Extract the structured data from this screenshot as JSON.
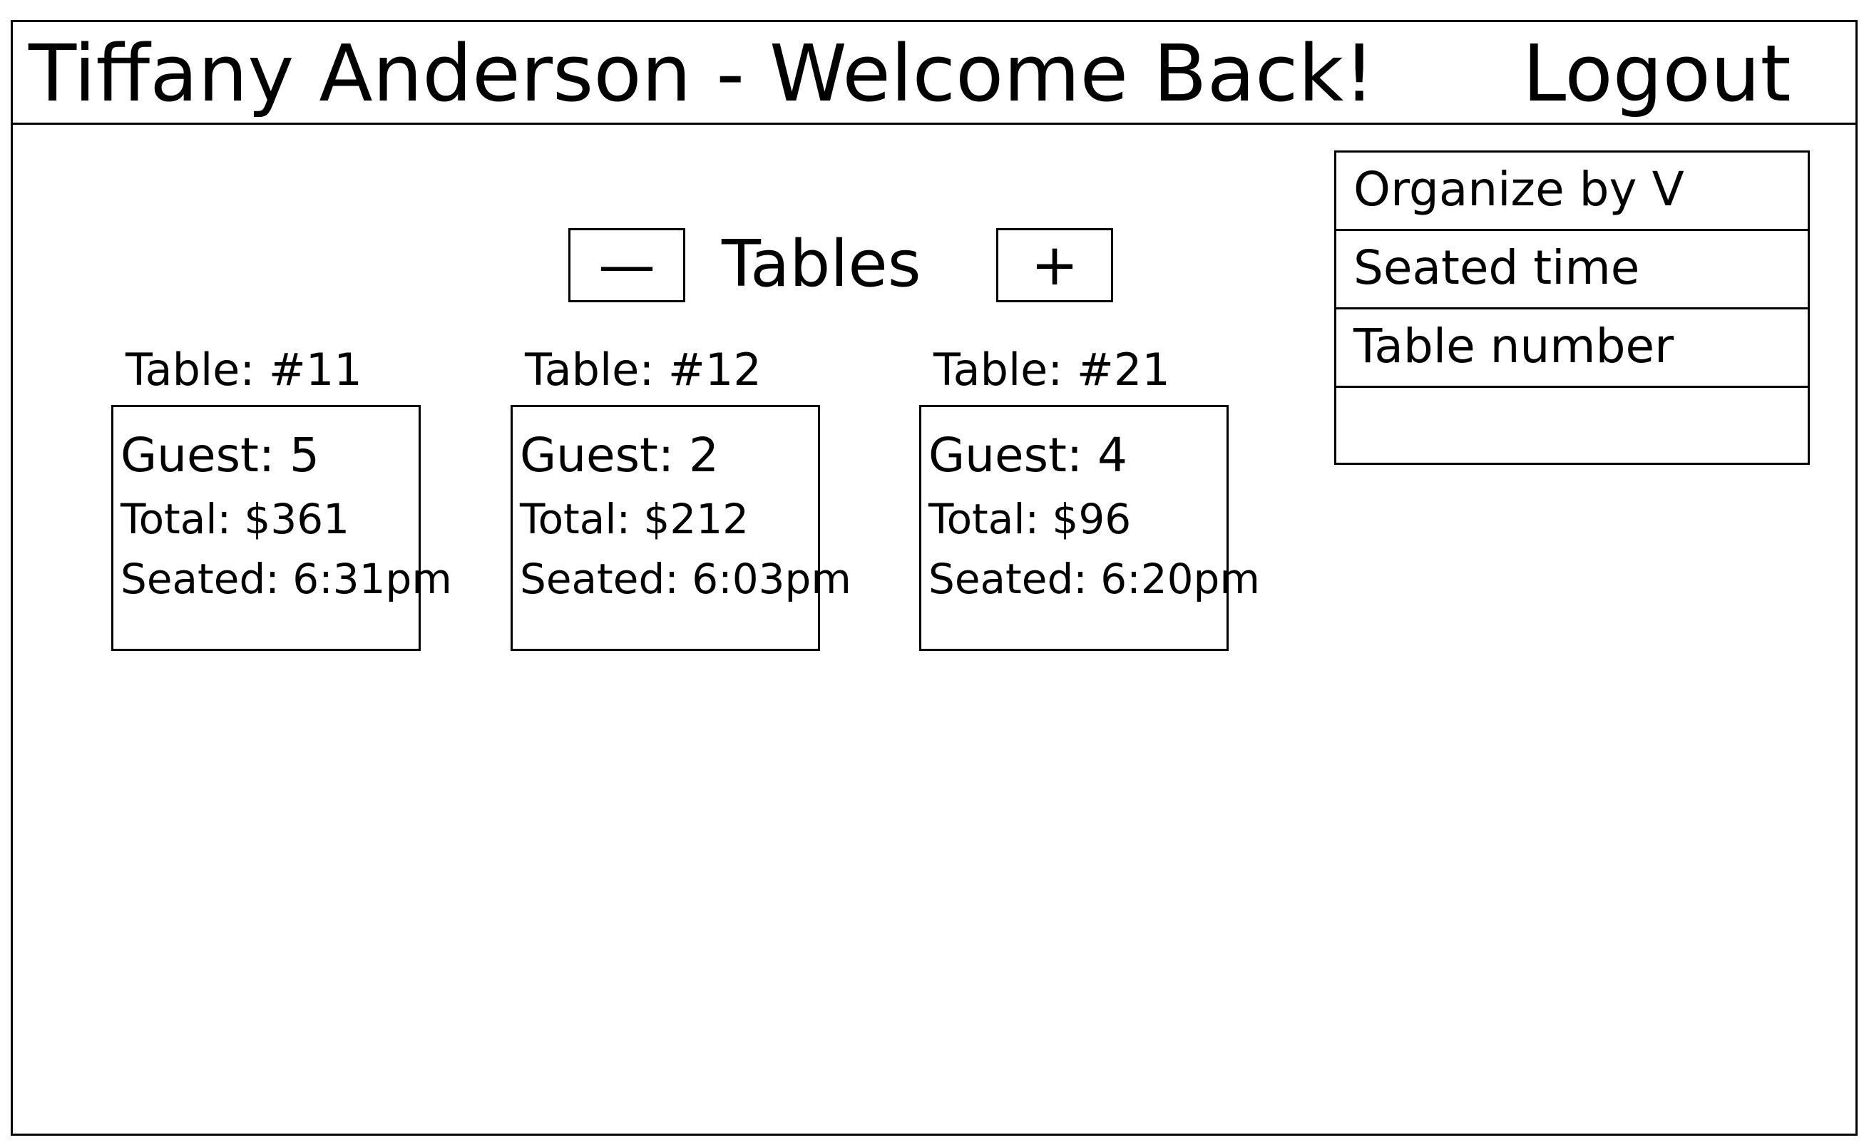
{
  "header": {
    "title": "Tiffany Anderson - Welcome Back!",
    "logout_label": "Logout"
  },
  "table_controls": {
    "minus_label": "—",
    "tables_label": "Tables",
    "plus_label": "+"
  },
  "tables": [
    {
      "title": "Table: #11",
      "guest": "Guest: 5",
      "total": "Total: $361",
      "seated": "Seated: 6:31pm"
    },
    {
      "title": "Table: #12",
      "guest": "Guest: 2",
      "total": "Total: $212",
      "seated": "Seated: 6:03pm"
    },
    {
      "title": "Table: #21",
      "guest": "Guest: 4",
      "total": "Total: $96",
      "seated": "Seated: 6:20pm"
    }
  ],
  "sort": {
    "header_label": "Organize by V",
    "options": [
      "Seated time",
      "Table number",
      ""
    ]
  }
}
